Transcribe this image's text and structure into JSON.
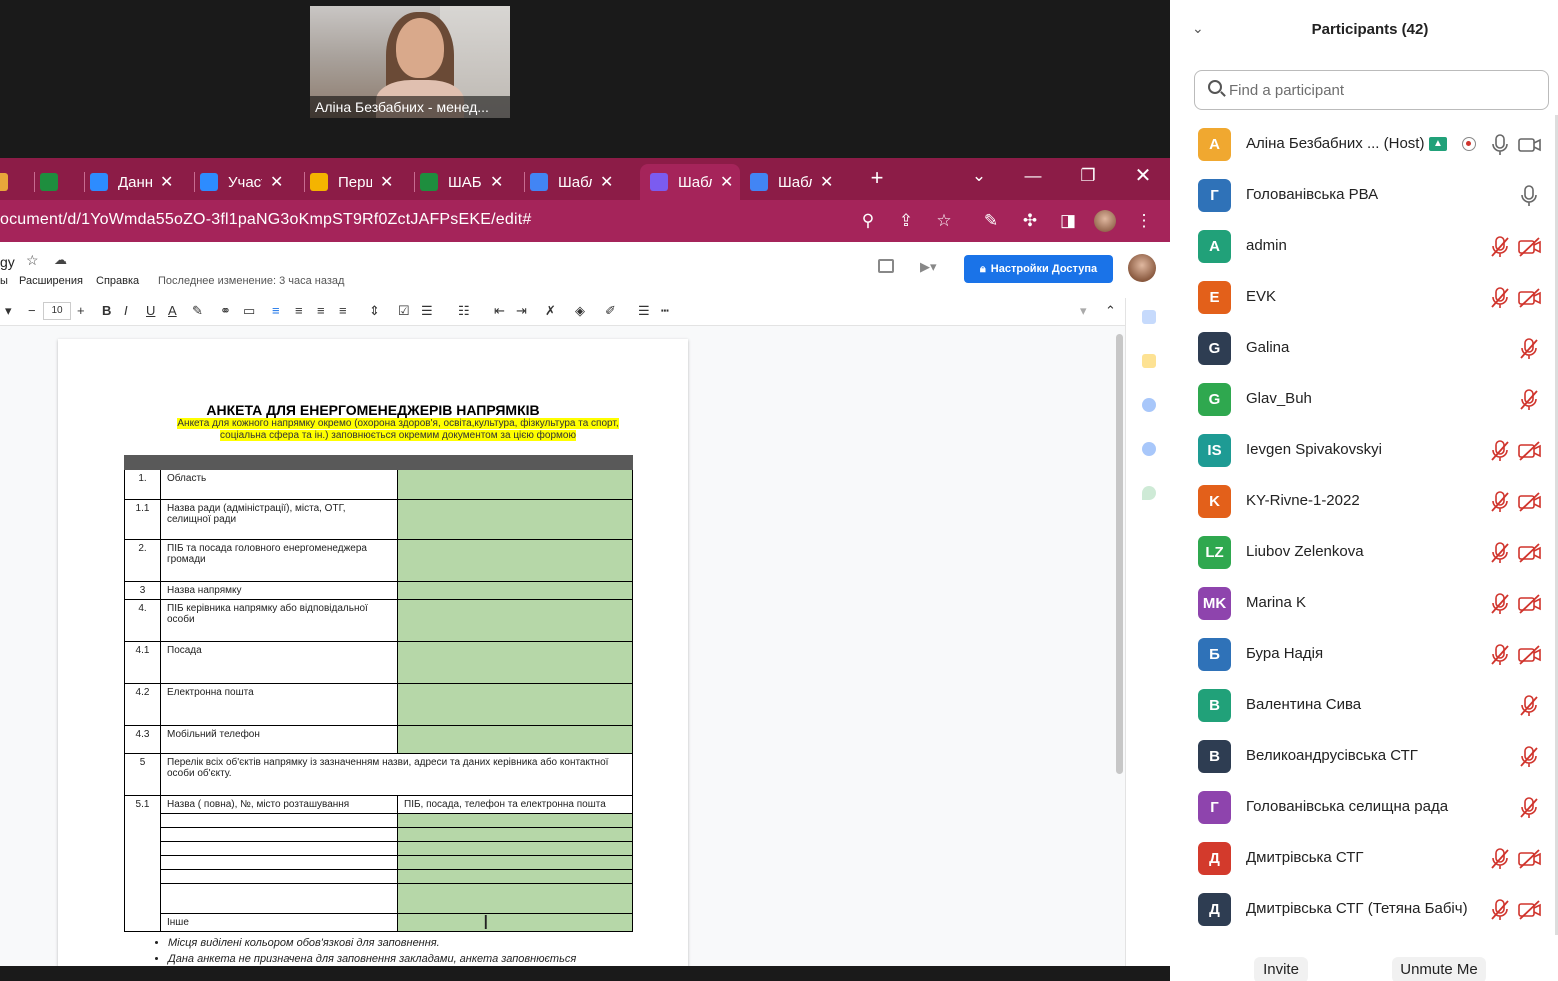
{
  "speaker": {
    "name": "Аліна Безбабних - менед..."
  },
  "browser": {
    "tabs": [
      {
        "label": "",
        "icon": "app-icon",
        "color": "#e8a73a"
      },
      {
        "label": "",
        "icon": "sheets-icon",
        "color": "#1e8e3e"
      },
      {
        "label": "Данн",
        "icon": "zoom-icon",
        "color": "#2d8cff"
      },
      {
        "label": "Участ",
        "icon": "zoom-icon",
        "color": "#2d8cff"
      },
      {
        "label": "Перш",
        "icon": "slides-icon",
        "color": "#f4b400"
      },
      {
        "label": "ШАБ",
        "icon": "sheets-icon",
        "color": "#1e8e3e"
      },
      {
        "label": "Шабл",
        "icon": "docs-icon",
        "color": "#4285f4"
      },
      {
        "label": "Шабл",
        "icon": "extension-icon",
        "color": "#7b5cf0"
      },
      {
        "label": "Шабл",
        "icon": "docs-icon",
        "color": "#4285f4"
      }
    ],
    "url": "ocument/d/1YoWmda55oZO-3fl1paNG3oKmpST9Rf0ZctJAFPsEKE/edit#"
  },
  "docs": {
    "title": "gy",
    "menu": [
      "ы",
      "Расширения",
      "Справка"
    ],
    "last_edit": "Последнее изменение: 3 часа назад",
    "share_label": "Настройки Доступа",
    "font_size": "10"
  },
  "document": {
    "heading": "АНКЕТА ДЛЯ ЕНЕРГОМЕНЕДЖЕРІВ НАПРЯМКІВ",
    "subheading": "Анкета для кожного напрямку окремо (охорона здоров'я, освіта,культура, фізкультура та спорт, соціальна сфера та ін.) заповнюється окремим документом за цією формою",
    "rows": [
      {
        "num": "1.",
        "label": "Область"
      },
      {
        "num": "1.1",
        "label": "Назва ради (адміністрації), міста, ОТГ, селищної ради"
      },
      {
        "num": "2.",
        "label": "ПІБ та посада головного енергоменеджера громади"
      },
      {
        "num": "3",
        "label": "Назва напрямку"
      },
      {
        "num": "4.",
        "label": "ПІБ керівника напрямку або відповідальної особи"
      },
      {
        "num": "4.1",
        "label": "Посада"
      },
      {
        "num": "4.2",
        "label": "Електронна пошта"
      },
      {
        "num": "4.3",
        "label": "Мобільний телефон"
      }
    ],
    "row5": {
      "num": "5",
      "label": "Перелік всіх об'єктів напрямку із зазначенням назви, адреси та даних керівника або контактної особи об'єкту."
    },
    "row51": {
      "num": "5.1",
      "col1": "Назва ( повна), №, місто розташування",
      "col2": "ПІБ, посада, телефон та електронна пошта"
    },
    "other": "Інше",
    "notes": [
      "Місця виділені кольором обов'язкові для заповнення.",
      "Дана анкета не призначена для заповнення закладами, анкета заповнюється"
    ]
  },
  "participants": {
    "title": "Participants (42)",
    "search_placeholder": "Find a participant",
    "list": [
      {
        "initials": "А",
        "name": "Аліна Безбабних ... (Host)",
        "color": "#f0a830",
        "mic": "on",
        "cam": "on"
      },
      {
        "initials": "Г",
        "name": "Голованівська РВА",
        "color": "#2f72b8",
        "mic": "on",
        "cam": "none"
      },
      {
        "initials": "A",
        "name": "admin",
        "color": "#21a179",
        "mic": "muted",
        "cam": "off"
      },
      {
        "initials": "E",
        "name": "EVK",
        "color": "#e3601a",
        "mic": "muted",
        "cam": "off"
      },
      {
        "initials": "G",
        "name": "Galina",
        "color": "#2e3d52",
        "mic": "muted",
        "cam": "none"
      },
      {
        "initials": "G",
        "name": "Glav_Buh",
        "color": "#2fa84f",
        "mic": "muted",
        "cam": "none"
      },
      {
        "initials": "IS",
        "name": "Ievgen Spivakovskyi",
        "color": "#1e9b94",
        "mic": "muted",
        "cam": "off"
      },
      {
        "initials": "K",
        "name": "KY-Rivne-1-2022",
        "color": "#e3601a",
        "mic": "muted",
        "cam": "off"
      },
      {
        "initials": "LZ",
        "name": "Liubov Zelenkova",
        "color": "#2fa84f",
        "mic": "muted",
        "cam": "off"
      },
      {
        "initials": "MK",
        "name": "Marina K",
        "color": "#8e44ad",
        "mic": "muted",
        "cam": "off"
      },
      {
        "initials": "Б",
        "name": "Бура Надія",
        "color": "#2f72b8",
        "mic": "muted",
        "cam": "off"
      },
      {
        "initials": "В",
        "name": "Валентина Сива",
        "color": "#21a179",
        "mic": "muted",
        "cam": "none"
      },
      {
        "initials": "В",
        "name": "Великоандрусівська СТГ",
        "color": "#2e3d52",
        "mic": "muted",
        "cam": "none"
      },
      {
        "initials": "Г",
        "name": "Голованівська селищна рада",
        "color": "#8e44ad",
        "mic": "muted",
        "cam": "none"
      },
      {
        "initials": "Д",
        "name": "Дмитрівська СТГ",
        "color": "#d33a2c",
        "mic": "muted",
        "cam": "off"
      },
      {
        "initials": "Д",
        "name": "Дмитрівська СТГ (Тетяна Бабіч)",
        "color": "#2e3d52",
        "mic": "muted",
        "cam": "off"
      }
    ],
    "invite_label": "Invite",
    "unmute_label": "Unmute Me"
  }
}
